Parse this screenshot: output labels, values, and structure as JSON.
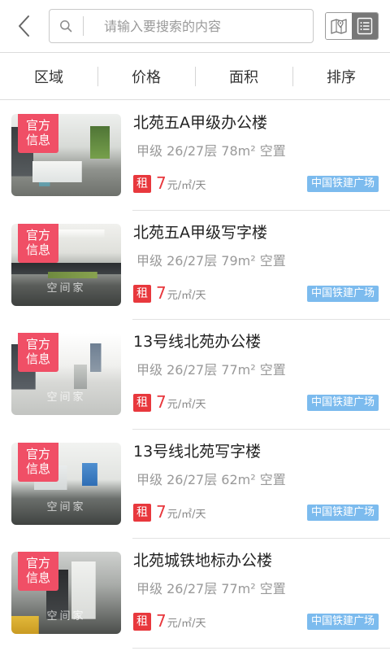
{
  "header": {
    "back_icon": "chevron-left-icon",
    "search": {
      "icon": "search-icon",
      "placeholder": "请输入要搜索的内容",
      "value": ""
    },
    "view_toggle": {
      "map_icon": "map-icon",
      "list_icon": "list-icon",
      "active": "list"
    }
  },
  "filters": [
    {
      "label": "区域"
    },
    {
      "label": "价格"
    },
    {
      "label": "面积"
    },
    {
      "label": "排序"
    }
  ],
  "listings": [
    {
      "badge_line1": "官方",
      "badge_line2": "信息",
      "title": "北苑五A甲级办公楼",
      "details": "甲级 26/27层 78m² 空置",
      "rent_tag": "租",
      "price": "7",
      "unit": "元/㎡/天",
      "location_tag": "中国铁建广场"
    },
    {
      "badge_line1": "官方",
      "badge_line2": "信息",
      "title": "北苑五A甲级写字楼",
      "details": "甲级 26/27层 79m² 空置",
      "rent_tag": "租",
      "price": "7",
      "unit": "元/㎡/天",
      "location_tag": "中国铁建广场",
      "watermark": "空间家"
    },
    {
      "badge_line1": "官方",
      "badge_line2": "信息",
      "title": "13号线北苑办公楼",
      "details": "甲级 26/27层 77m² 空置",
      "rent_tag": "租",
      "price": "7",
      "unit": "元/㎡/天",
      "location_tag": "中国铁建广场",
      "watermark": "空间家"
    },
    {
      "badge_line1": "官方",
      "badge_line2": "信息",
      "title": "13号线北苑写字楼",
      "details": "甲级 26/27层 62m² 空置",
      "rent_tag": "租",
      "price": "7",
      "unit": "元/㎡/天",
      "location_tag": "中国铁建广场",
      "watermark": "空间家"
    },
    {
      "badge_line1": "官方",
      "badge_line2": "信息",
      "title": "北苑城铁地标办公楼",
      "details": "甲级 26/27层 77m² 空置",
      "rent_tag": "租",
      "price": "7",
      "unit": "元/㎡/天",
      "location_tag": "中国铁建广场",
      "watermark": "空间家"
    }
  ],
  "colors": {
    "accent_red": "#e8383d",
    "badge_pink": "#f04f66",
    "tag_blue": "#7cbbee",
    "toggle_active": "#777777"
  }
}
